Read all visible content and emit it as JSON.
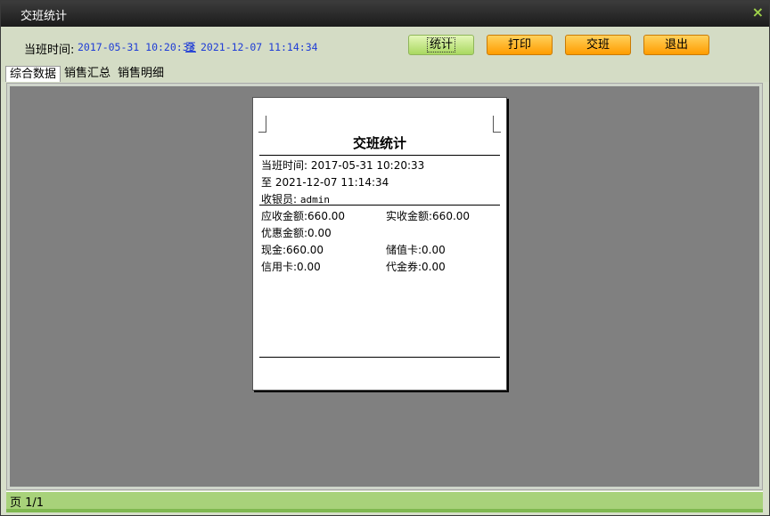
{
  "window": {
    "title": "交班统计",
    "close_label": "×"
  },
  "toolbar": {
    "time_label": "当班时间:",
    "start_time": "2017-05-31 10:20:33",
    "to_text": "至",
    "end_time": "2021-12-07 11:14:34",
    "buttons": {
      "stats": "统计",
      "print": "打印",
      "shift": "交班",
      "exit": "退出"
    }
  },
  "tabs": [
    "综合数据",
    "销售汇总",
    "销售明细"
  ],
  "receipt": {
    "title": "交班统计",
    "shift_time": "当班时间: 2017-05-31 10:20:33",
    "to_time": "至 2021-12-07 11:14:34",
    "cashier_label": "收银员: ",
    "cashier": "admin",
    "receivable": "应收金额:660.00",
    "received": "实收金额:660.00",
    "discount": "优惠金额:0.00",
    "cash": "现金:660.00",
    "stored_card": "储值卡:0.00",
    "credit_card": "信用卡:0.00",
    "voucher": "代金券:0.00"
  },
  "status": {
    "page": "页 1/1"
  },
  "colors": {
    "accent_green": "#a8d27a",
    "button_orange": "#ffa500",
    "link_blue": "#1e3cd6"
  }
}
